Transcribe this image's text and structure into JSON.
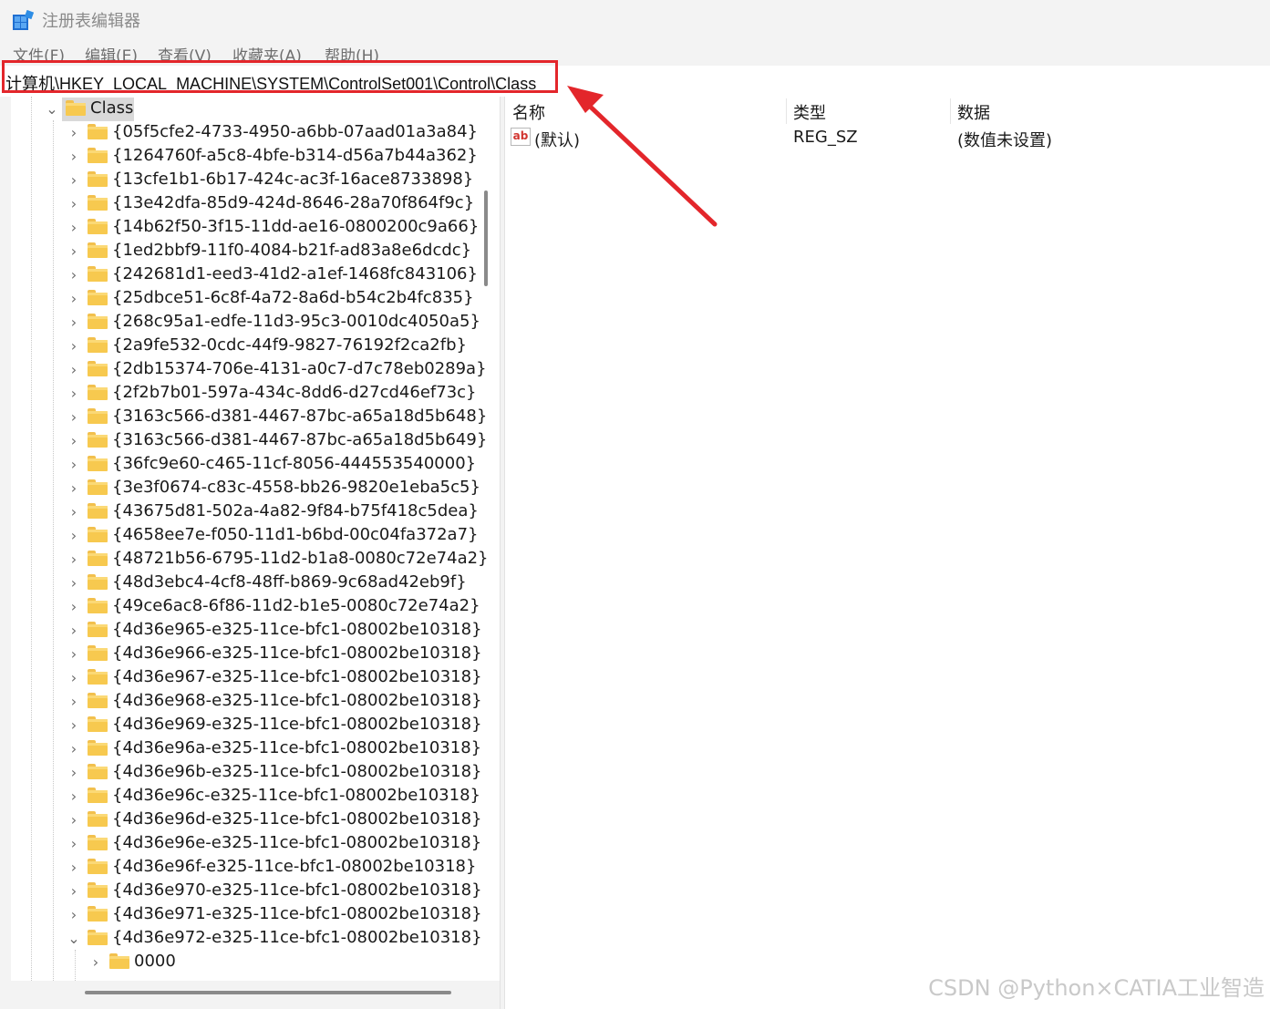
{
  "window": {
    "title": "注册表编辑器"
  },
  "menu": [
    "文件(F)",
    "编辑(E)",
    "查看(V)",
    "收藏夹(A)",
    "帮助(H)"
  ],
  "address": "计算机\\HKEY_LOCAL_MACHINE\\SYSTEM\\ControlSet001\\Control\\Class",
  "tree": {
    "selected": "Class",
    "children": [
      "{05f5cfe2-4733-4950-a6bb-07aad01a3a84}",
      "{1264760f-a5c8-4bfe-b314-d56a7b44a362}",
      "{13cfe1b1-6b17-424c-ac3f-16ace8733898}",
      "{13e42dfa-85d9-424d-8646-28a70f864f9c}",
      "{14b62f50-3f15-11dd-ae16-0800200c9a66}",
      "{1ed2bbf9-11f0-4084-b21f-ad83a8e6dcdc}",
      "{242681d1-eed3-41d2-a1ef-1468fc843106}",
      "{25dbce51-6c8f-4a72-8a6d-b54c2b4fc835}",
      "{268c95a1-edfe-11d3-95c3-0010dc4050a5}",
      "{2a9fe532-0cdc-44f9-9827-76192f2ca2fb}",
      "{2db15374-706e-4131-a0c7-d7c78eb0289a}",
      "{2f2b7b01-597a-434c-8dd6-d27cd46ef73c}",
      "{3163c566-d381-4467-87bc-a65a18d5b648}",
      "{3163c566-d381-4467-87bc-a65a18d5b649}",
      "{36fc9e60-c465-11cf-8056-444553540000}",
      "{3e3f0674-c83c-4558-bb26-9820e1eba5c5}",
      "{43675d81-502a-4a82-9f84-b75f418c5dea}",
      "{4658ee7e-f050-11d1-b6bd-00c04fa372a7}",
      "{48721b56-6795-11d2-b1a8-0080c72e74a2}",
      "{48d3ebc4-4cf8-48ff-b869-9c68ad42eb9f}",
      "{49ce6ac8-6f86-11d2-b1e5-0080c72e74a2}",
      "{4d36e965-e325-11ce-bfc1-08002be10318}",
      "{4d36e966-e325-11ce-bfc1-08002be10318}",
      "{4d36e967-e325-11ce-bfc1-08002be10318}",
      "{4d36e968-e325-11ce-bfc1-08002be10318}",
      "{4d36e969-e325-11ce-bfc1-08002be10318}",
      "{4d36e96a-e325-11ce-bfc1-08002be10318}",
      "{4d36e96b-e325-11ce-bfc1-08002be10318}",
      "{4d36e96c-e325-11ce-bfc1-08002be10318}",
      "{4d36e96d-e325-11ce-bfc1-08002be10318}",
      "{4d36e96e-e325-11ce-bfc1-08002be10318}",
      "{4d36e96f-e325-11ce-bfc1-08002be10318}",
      "{4d36e970-e325-11ce-bfc1-08002be10318}",
      "{4d36e971-e325-11ce-bfc1-08002be10318}",
      "{4d36e972-e325-11ce-bfc1-08002be10318}"
    ],
    "expanded_child": "{4d36e972-e325-11ce-bfc1-08002be10318}",
    "grandchildren": [
      "0000"
    ]
  },
  "values": {
    "headers": {
      "name": "名称",
      "type": "类型",
      "data": "数据"
    },
    "rows": [
      {
        "icon": "string-value-icon",
        "icon_text": "ab",
        "name": "(默认)",
        "type": "REG_SZ",
        "data": "(数值未设置)"
      }
    ]
  },
  "annotation": {
    "color": "#e3262b"
  },
  "watermark": "CSDN @Python×CATIA工业智造"
}
